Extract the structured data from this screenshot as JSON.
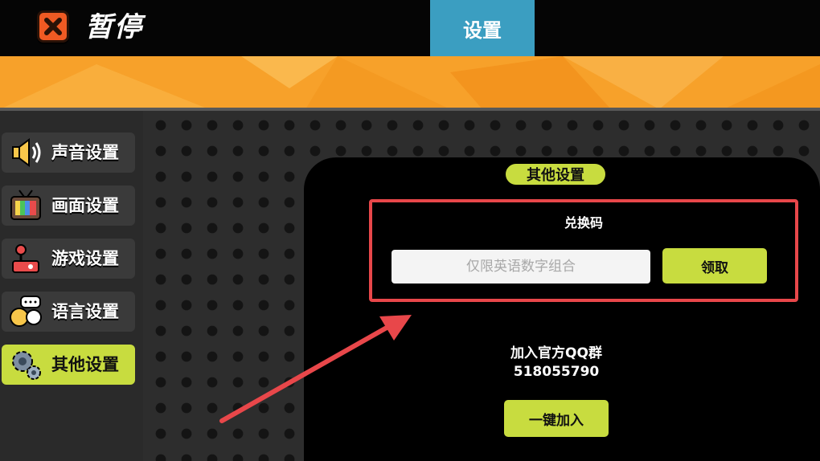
{
  "header": {
    "title": "暂停",
    "close_icon": "close-x-icon",
    "active_tab": "设置"
  },
  "sidebar": {
    "items": [
      {
        "label": "声音设置",
        "icon": "speaker-icon",
        "active": false
      },
      {
        "label": "画面设置",
        "icon": "tv-icon",
        "active": false
      },
      {
        "label": "游戏设置",
        "icon": "joystick-icon",
        "active": false
      },
      {
        "label": "语言设置",
        "icon": "chat-icon",
        "active": false
      },
      {
        "label": "其他设置",
        "icon": "gear-icon",
        "active": true
      }
    ]
  },
  "panel": {
    "title": "其他设置",
    "redeem": {
      "label": "兑换码",
      "placeholder": "仅限英语数字组合",
      "button": "领取"
    },
    "qq_group": {
      "label": "加入官方QQ群",
      "number": "518055790",
      "button": "一键加入"
    }
  },
  "colors": {
    "accent": "#c8dc3f",
    "tab": "#3b9ec1",
    "banner": "#f7a12a",
    "highlight": "#e8474a"
  }
}
